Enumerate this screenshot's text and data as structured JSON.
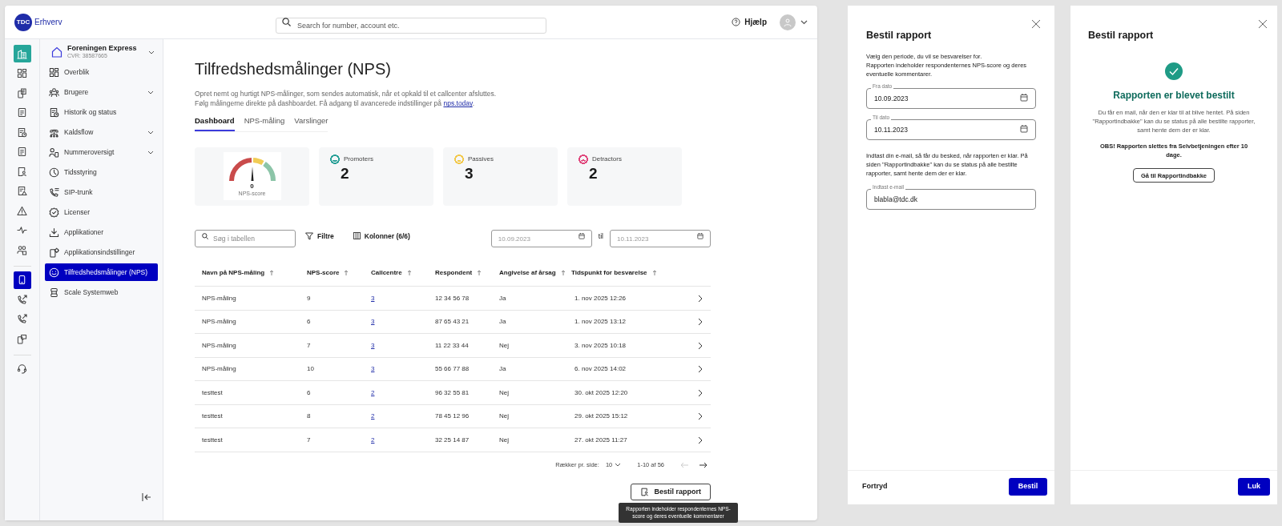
{
  "header": {
    "logo": "TDC",
    "logo_suffix": "Erhverv",
    "search": {
      "placeholder": "Search for number, account etc."
    },
    "help": "Hjælp"
  },
  "rail": [
    [
      {
        "selected": true
      },
      {
        "selected": false
      },
      {
        "selected": false
      },
      {
        "selected": false
      },
      {
        "selected": false
      },
      {
        "selected": false
      },
      {
        "selected": false
      },
      {
        "selected": false
      },
      {
        "selected": false
      },
      {
        "selected": false
      },
      {
        "selected": false
      }
    ],
    [
      {
        "selected": true
      },
      {
        "selected": false
      },
      {
        "selected": false
      },
      {
        "selected": false
      }
    ],
    [
      {
        "selected": false
      }
    ]
  ],
  "account": {
    "name": "Foreningen Express",
    "cvr": "CVR: 38587665",
    "expandable": true
  },
  "nav": [
    {
      "label": "Overblik",
      "selected": false,
      "expandable": false
    },
    {
      "label": "Brugere",
      "selected": false,
      "expandable": true
    },
    {
      "label": "Historik og status",
      "selected": false,
      "expandable": false
    },
    {
      "label": "Kaldsflow",
      "selected": false,
      "expandable": true
    },
    {
      "label": "Nummeroversigt",
      "selected": false,
      "expandable": true
    },
    {
      "label": "Tidsstyring",
      "selected": false,
      "expandable": false
    },
    {
      "label": "SIP-trunk",
      "selected": false,
      "expandable": false
    },
    {
      "label": "Licenser",
      "selected": false,
      "expandable": false
    },
    {
      "label": "Applikationer",
      "selected": false,
      "expandable": false
    },
    {
      "label": "Applikationsindstillinger",
      "selected": false,
      "expandable": false
    },
    {
      "label": "Tilfredshedsmålinger (NPS)",
      "selected": true,
      "expandable": false
    },
    {
      "label": "Scale Systemweb",
      "selected": false,
      "expandable": false
    }
  ],
  "page": {
    "title": "Tilfredshedsmålinger (NPS)",
    "description": "Opret nemt og hurtigt NPS-målinger, som sendes automatisk, når et opkald til et callcenter afsluttes. Følg målingerne direkte på dashboardet. Få adgang til avancerede indstillinger på",
    "link": "nps.today",
    "description_end": "."
  },
  "tabs": [
    {
      "label": "Dashboard",
      "selected": true
    },
    {
      "label": "NPS-måling",
      "selected": false
    },
    {
      "label": "Varslinger",
      "selected": false
    }
  ],
  "gauge": {
    "score": "0",
    "label": "NPS-score"
  },
  "stats": [
    {
      "label": "Promoters",
      "value": "2",
      "color": "#2aa198"
    },
    {
      "label": "Passives",
      "value": "3",
      "color": "#f2c94c"
    },
    {
      "label": "Detractors",
      "value": "2",
      "color": "#e0457b"
    }
  ],
  "toolbar": {
    "search": {
      "placeholder": "Søg i tabellen"
    },
    "filter": "Filtre",
    "columns": "Kolonner (6/6)",
    "from": {
      "placeholder": "10.09.2023"
    },
    "to_label": "til",
    "to": {
      "placeholder": "10.11.2023"
    }
  },
  "table": {
    "columns": [
      "Navn på NPS-måling",
      "NPS-score",
      "Callcentre",
      "Respondent",
      "Angivelse af årsag",
      "Tidspunkt for besvarelse"
    ],
    "rows": [
      [
        "NPS-måling",
        "9",
        "3",
        "12 34 56 78",
        "Ja",
        "1. nov 2025 12:26"
      ],
      [
        "NPS-måling",
        "6",
        "3",
        "87 65 43 21",
        "Ja",
        "1. nov 2025 13:12"
      ],
      [
        "NPS-måling",
        "7",
        "3",
        "11 22 33 44",
        "Nej",
        "3. nov 2025 10:18"
      ],
      [
        "NPS-måling",
        "10",
        "3",
        "55 66 77 88",
        "Ja",
        "6. nov 2025 14:02"
      ],
      [
        "testtest",
        "6",
        "2",
        "96 32 55 81",
        "Nej",
        "30. okt 2025 12:20"
      ],
      [
        "testtest",
        "8",
        "2",
        "78 45 12 96",
        "Nej",
        "29. okt 2025 15:12"
      ],
      [
        "testtest",
        "7",
        "2",
        "32 25 14 87",
        "Nej",
        "27. okt 2025 11:27"
      ]
    ]
  },
  "pagination": {
    "rows_label": "Rækker pr. side:",
    "rows_value": "10",
    "range": "1-10 af 56",
    "prev": {
      "disabled": true
    },
    "next": {
      "disabled": false
    }
  },
  "report_button": "Bestil rapport",
  "tooltip": "Rapporten indeholder respondenternes NPS-score og deres eventuelle kommentarer",
  "order_panel": {
    "title": "Bestil rapport",
    "intro": [
      "Vælg den periode, du vil se besvarelser for.",
      "Rapporten indeholder respondenternes NPS-score og deres eventuelle kommentarer."
    ],
    "dates": [
      {
        "label": "Fra dato",
        "value": "10.09.2023"
      },
      {
        "label": "Til dato",
        "value": "10.11.2023"
      }
    ],
    "email_intro": "Indtast din e-mail, så får du besked, når rapporten er klar. På siden \"Rapportindbakke\" kan du se status på alle bestilte rapporter, samt hente dem der er klar.",
    "email": {
      "label": "Indtast e-mail",
      "value": "blabla@tdc.dk"
    },
    "cancel": "Fortryd",
    "submit": "Bestil"
  },
  "confirm_panel": {
    "title": "Bestil rapport",
    "heading": "Rapporten er blevet bestilt",
    "message": "Du får en mail, når den er klar til at blive hentet. På siden \"Rapportindbakke\" kan du se status på alle bestilte rapporter, samt hente dem der er klar.",
    "notice": "OBS! Rapporten slettes fra Selvbetjeningen efter 10 dage.",
    "inbox_button": "Gå til Rapportindbakke",
    "close_button": "Luk"
  }
}
